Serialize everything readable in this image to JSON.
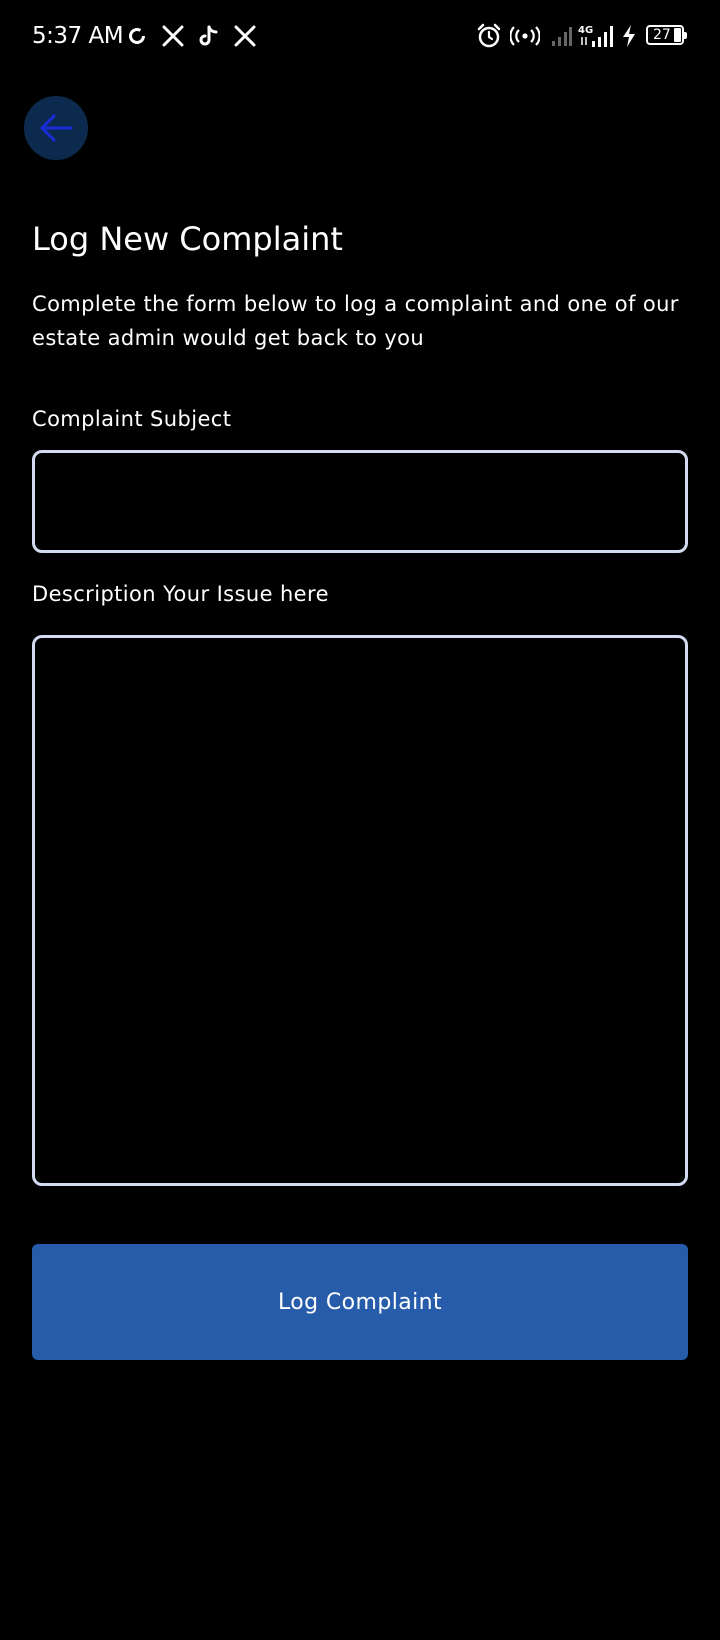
{
  "status_bar": {
    "time": "5:37 AM",
    "battery_level": "27",
    "notification_icons": [
      "sync-icon",
      "x-logo-icon",
      "tiktok-icon",
      "x-logo-icon"
    ],
    "system_icons": [
      "alarm-icon",
      "hotspot-icon",
      "signal-weak-icon",
      "signal-4g-icon",
      "charging-icon",
      "battery-icon"
    ]
  },
  "header": {
    "back_icon": "arrow-left-icon",
    "title": "Log New Complaint",
    "subtitle": "Complete the form below to log a complaint and one of our estate admin would get back to you"
  },
  "form": {
    "subject_label": "Complaint Subject",
    "subject_value": "",
    "description_label": "Description Your Issue here",
    "description_value": "",
    "submit_label": "Log Complaint"
  },
  "colors": {
    "background": "#000000",
    "primary_button": "#275cab",
    "back_button_bg": "#0b2a4e",
    "back_arrow": "#1a2bd0",
    "input_border": "#d3dbf1"
  }
}
